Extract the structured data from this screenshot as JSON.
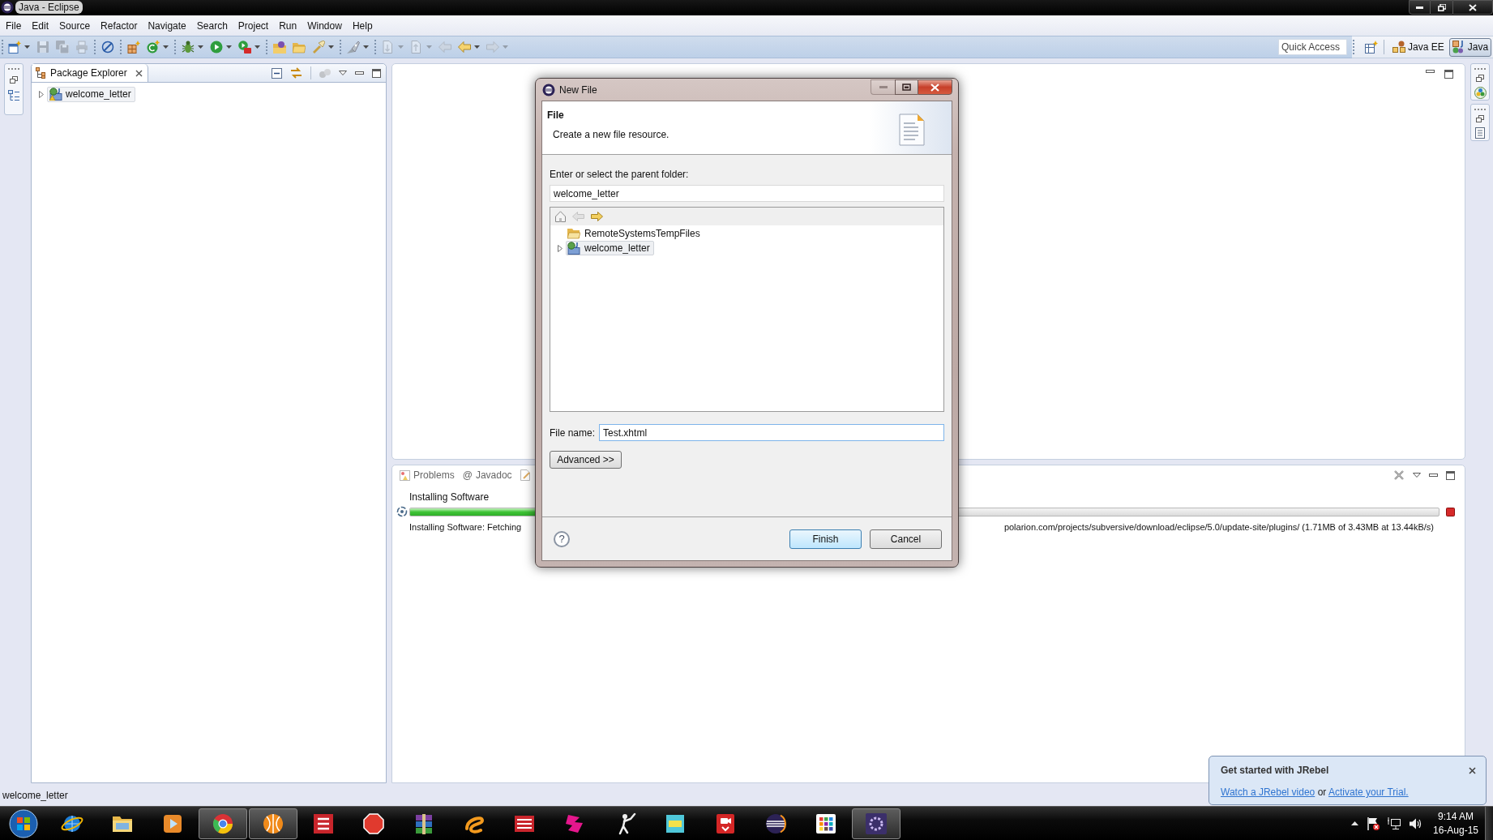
{
  "window": {
    "title": "Java - Eclipse"
  },
  "menu_bar": [
    "File",
    "Edit",
    "Source",
    "Refactor",
    "Navigate",
    "Search",
    "Project",
    "Run",
    "Window",
    "Help"
  ],
  "toolbar": {
    "groups": [
      {
        "items": [
          {
            "kind": "new",
            "dropdown": true,
            "disabled": false
          },
          {
            "kind": "save",
            "dropdown": false,
            "disabled": true
          },
          {
            "kind": "save-all",
            "dropdown": false,
            "disabled": true
          },
          {
            "kind": "print",
            "dropdown": false,
            "disabled": true
          }
        ]
      },
      {
        "items": [
          {
            "kind": "mark",
            "dropdown": false,
            "disabled": false
          }
        ]
      },
      {
        "items": [
          {
            "kind": "package",
            "dropdown": false,
            "disabled": false
          },
          {
            "kind": "class",
            "dropdown": true,
            "disabled": false
          }
        ]
      },
      {
        "items": [
          {
            "kind": "debug",
            "dropdown": true,
            "disabled": false
          },
          {
            "kind": "run",
            "dropdown": true,
            "disabled": false
          },
          {
            "kind": "external",
            "dropdown": true,
            "disabled": false
          }
        ]
      },
      {
        "items": [
          {
            "kind": "folder-globe",
            "dropdown": false,
            "disabled": false
          },
          {
            "kind": "folder",
            "dropdown": false,
            "disabled": false
          },
          {
            "kind": "torch",
            "dropdown": true,
            "disabled": false
          }
        ]
      },
      {
        "items": [
          {
            "kind": "rocket",
            "dropdown": true,
            "disabled": false
          }
        ]
      },
      {
        "items": [
          {
            "kind": "next-annotation",
            "dropdown": true,
            "disabled": true
          },
          {
            "kind": "prev-annotation",
            "dropdown": true,
            "disabled": true
          },
          {
            "kind": "last-edit",
            "dropdown": false,
            "disabled": true
          },
          {
            "kind": "back",
            "dropdown": true,
            "disabled": false
          },
          {
            "kind": "forward",
            "dropdown": true,
            "disabled": true
          }
        ]
      }
    ],
    "quick_access": {
      "placeholder": "Quick Access"
    },
    "perspectives": [
      {
        "label": "Java EE",
        "kind": "java-ee",
        "selected": false
      },
      {
        "label": "Java",
        "kind": "java",
        "selected": true
      }
    ]
  },
  "package_explorer": {
    "title": "Package Explorer",
    "tree": [
      {
        "label": "welcome_letter",
        "kind": "project",
        "expandable": true,
        "warning": true,
        "selected": true
      }
    ]
  },
  "bottom_panel": {
    "tabs": [
      {
        "label": "Problems",
        "kind": "problems",
        "selected": false
      },
      {
        "label": "Javadoc",
        "kind": "javadoc",
        "glyph": "@",
        "selected": false
      },
      {
        "kind": "declaration",
        "selected": false
      }
    ],
    "progress": {
      "title": "Installing Software",
      "level": 0.4,
      "detail_visible_start": "Installing Software: Fetching",
      "detail_visible_end": "polarion.com/projects/subversive/download/eclipse/5.0/update-site/plugins/ (1.71MB of 3.43MB at 13.44kB/s)"
    }
  },
  "dialog": {
    "title": "New File",
    "window_buttons": [
      {
        "kind": "minimize",
        "disabled": true
      },
      {
        "kind": "maximize",
        "disabled": false
      },
      {
        "kind": "close",
        "disabled": false
      }
    ],
    "heading": "File",
    "description": "Create a new file resource.",
    "folder_label": "Enter or select the parent folder:",
    "folder_value": "welcome_letter",
    "tree_toolbar": [
      {
        "kind": "home",
        "disabled": false
      },
      {
        "kind": "back",
        "disabled": true
      },
      {
        "kind": "forward",
        "disabled": false
      }
    ],
    "tree": [
      {
        "label": "RemoteSystemsTempFiles",
        "kind": "folder",
        "expandable": false,
        "selected": false
      },
      {
        "label": "welcome_letter",
        "kind": "project",
        "expandable": true,
        "selected": true
      }
    ],
    "file_name_label": "File name:",
    "file_name_value": "Test.xhtml",
    "advanced_button": "Advanced >>",
    "help": "?",
    "buttons": [
      {
        "label": "Finish",
        "default": true
      },
      {
        "label": "Cancel",
        "default": false
      }
    ]
  },
  "status_bar": {
    "text": "welcome_letter"
  },
  "notification": {
    "title": "Get started with JRebel",
    "message": [
      {
        "kind": "link",
        "text": "Watch a JRebel video"
      },
      {
        "kind": "text",
        "text": "or"
      },
      {
        "kind": "link",
        "text": "Activate your Trial."
      }
    ]
  },
  "taskbar": {
    "apps": [
      {
        "kind": "globe",
        "active": false
      },
      {
        "kind": "folder",
        "active": false
      },
      {
        "kind": "media",
        "active": false
      },
      {
        "kind": "wheel",
        "active": true
      },
      {
        "kind": "sphere",
        "active": true
      },
      {
        "kind": "bars",
        "active": false
      },
      {
        "kind": "octagon",
        "active": false
      },
      {
        "kind": "books",
        "active": false
      },
      {
        "kind": "swirl",
        "active": false
      },
      {
        "kind": "stripes",
        "active": false
      },
      {
        "kind": "emblem",
        "active": false
      },
      {
        "kind": "figure",
        "active": false
      },
      {
        "kind": "tile",
        "active": false
      },
      {
        "kind": "camera",
        "active": false
      },
      {
        "kind": "disc",
        "active": false
      },
      {
        "kind": "grid",
        "active": false
      },
      {
        "kind": "gear",
        "active": true
      }
    ],
    "clock": {
      "time": "9:14 AM",
      "date": "16-Aug-15"
    }
  }
}
